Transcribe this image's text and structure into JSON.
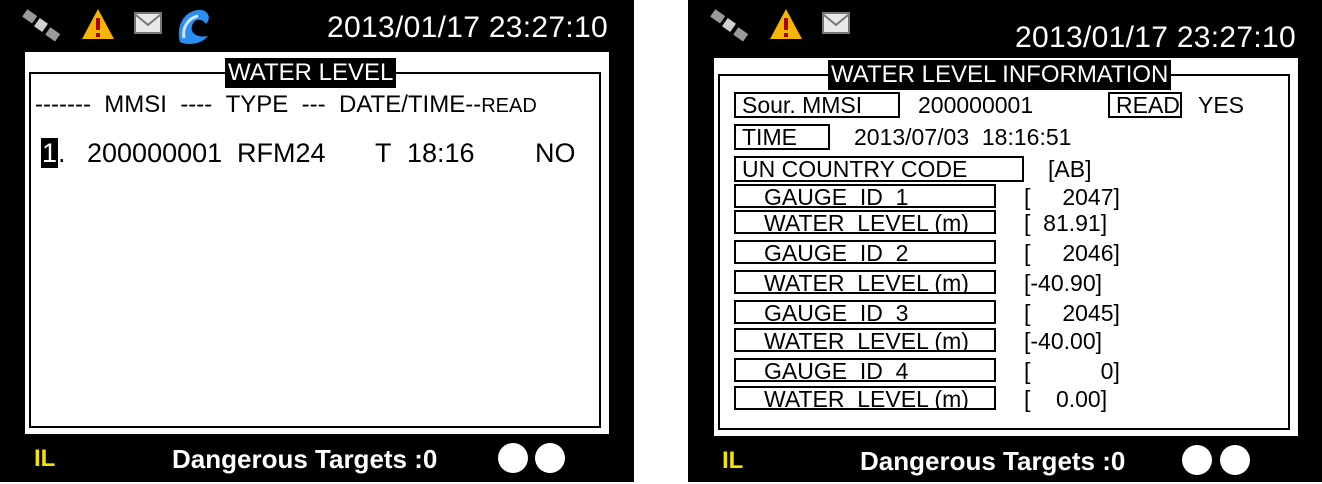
{
  "status": {
    "icons": [
      "satellite-icon",
      "warning-icon",
      "mail-icon",
      "wave-icon"
    ],
    "datetime": "2013/01/17 23:27:10"
  },
  "left": {
    "title": "WATER LEVEL",
    "header": {
      "dashes1": "-------",
      "mmsi": "MMSI",
      "dashes2": "----",
      "type": "TYPE",
      "dashes3": "---",
      "datetime": "DATE/TIME--",
      "read": "READ"
    },
    "rows": [
      {
        "index": "1",
        "sep": ".",
        "mmsi": "200000001",
        "type": "RFM24",
        "flag": "T",
        "time": "18:16",
        "read": "NO"
      }
    ]
  },
  "right": {
    "title": "WATER LEVEL INFORMATION",
    "source_label": "Sour. MMSI",
    "source_value": "200000001",
    "read_label": "READ",
    "read_value": "YES",
    "time_label": "TIME",
    "time_value": "2013/07/03  18:16:51",
    "country_label": "UN COUNTRY CODE",
    "country_value": "[AB]",
    "fields": [
      {
        "label": "GAUGE  ID  1",
        "value": "[     2047]"
      },
      {
        "label": "WATER  LEVEL (m)",
        "value": "[  81.91]"
      },
      {
        "label": "GAUGE  ID  2",
        "value": "[     2046]"
      },
      {
        "label": "WATER  LEVEL (m)",
        "value": "[-40.90]"
      },
      {
        "label": "GAUGE  ID  3",
        "value": "[     2045]"
      },
      {
        "label": "WATER  LEVEL (m)",
        "value": "[-40.00]"
      },
      {
        "label": "GAUGE  ID  4",
        "value": "[           0]"
      },
      {
        "label": "WATER  LEVEL (m)",
        "value": "[    0.00]"
      }
    ]
  },
  "footer": {
    "mode": "IL",
    "danger": "Dangerous Targets :0"
  },
  "colors": {
    "mode_text": "#f2e600",
    "warning": "#f5b400",
    "wave": "#2a8ff0"
  }
}
